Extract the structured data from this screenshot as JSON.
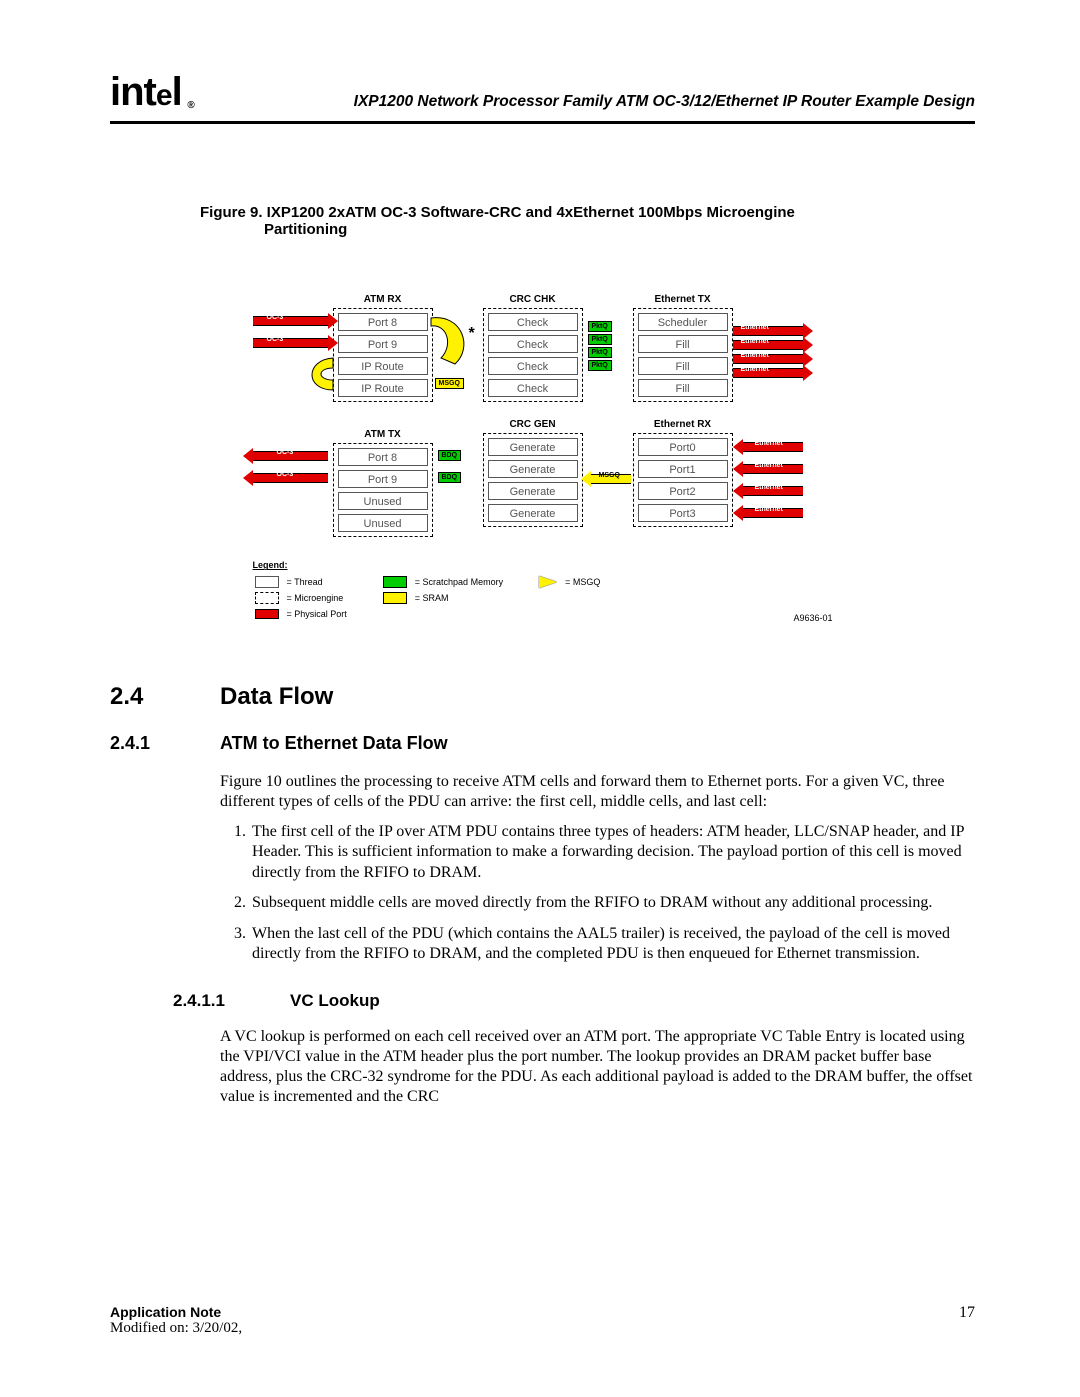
{
  "header": {
    "logo_text": "intel",
    "reg": "®",
    "doc_title": "IXP1200 Network Processor Family ATM OC-3/12/Ethernet IP Router Example Design"
  },
  "figure": {
    "caption_line1": "Figure 9.  IXP1200 2xATM OC-3 Software-CRC and 4xEthernet 100Mbps Microengine",
    "caption_line2": "Partitioning",
    "id": "A9636-01",
    "engines": {
      "atm_rx": {
        "title": "ATM RX",
        "threads": [
          "Port 8",
          "Port 9",
          "IP Route",
          "IP Route"
        ]
      },
      "crc_chk": {
        "title": "CRC CHK",
        "threads": [
          "Check",
          "Check",
          "Check",
          "Check"
        ]
      },
      "eth_tx": {
        "title": "Ethernet TX",
        "threads": [
          "Scheduler",
          "Fill",
          "Fill",
          "Fill"
        ]
      },
      "atm_tx": {
        "title": "ATM TX",
        "threads": [
          "Port 8",
          "Port 9",
          "Unused",
          "Unused"
        ]
      },
      "crc_gen": {
        "title": "CRC GEN",
        "threads": [
          "Generate",
          "Generate",
          "Generate",
          "Generate"
        ]
      },
      "eth_rx": {
        "title": "Ethernet RX",
        "threads": [
          "Port0",
          "Port1",
          "Port2",
          "Port3"
        ]
      }
    },
    "labels": {
      "oc3": "OC-3",
      "ethernet": "Ethernet",
      "msgq": "MSGQ",
      "bdq": "BDQ",
      "pktq": "PktQ"
    },
    "legend": {
      "heading": "Legend:",
      "items": [
        {
          "k": "thread",
          "v": "= Thread"
        },
        {
          "k": "me",
          "v": "= Microengine"
        },
        {
          "k": "port",
          "v": "= Physical Port"
        },
        {
          "k": "scr",
          "v": "= Scratchpad Memory"
        },
        {
          "k": "sram",
          "v": "= SRAM"
        },
        {
          "k": "msgq",
          "v": "= MSGQ"
        }
      ]
    }
  },
  "sections": {
    "s24": {
      "num": "2.4",
      "title": "Data Flow"
    },
    "s241": {
      "num": "2.4.1",
      "title": "ATM to Ethernet Data Flow"
    },
    "s2411": {
      "num": "2.4.1.1",
      "title": "VC Lookup"
    }
  },
  "body": {
    "p1": "Figure 10 outlines the processing to receive ATM cells and forward them to Ethernet ports. For a given VC, three different types of cells of the PDU can arrive: the first cell, middle cells, and last cell:",
    "li1": "The first cell of the IP over ATM PDU contains three types of headers: ATM header, LLC/SNAP header, and IP Header. This is sufficient information to make a forwarding decision. The payload portion of this cell is moved directly from the RFIFO to DRAM.",
    "li2": "Subsequent middle cells are moved directly from the RFIFO to DRAM without any additional processing.",
    "li3": "When the last cell of the PDU (which contains the AAL5 trailer) is received, the payload of the cell is moved directly from the RFIFO to DRAM, and the completed PDU is then enqueued for Ethernet transmission.",
    "p2": "A VC lookup is performed on each cell received over an ATM port. The appropriate VC Table Entry is located using the VPI/VCI value in the ATM header plus the port number. The lookup provides an DRAM packet buffer base address, plus the CRC-32 syndrome for the PDU. As each additional payload is added to the DRAM buffer, the offset value is incremented and the CRC"
  },
  "footer": {
    "note": "Application Note",
    "modified": "Modified on: 3/20/02,",
    "page": "17"
  }
}
